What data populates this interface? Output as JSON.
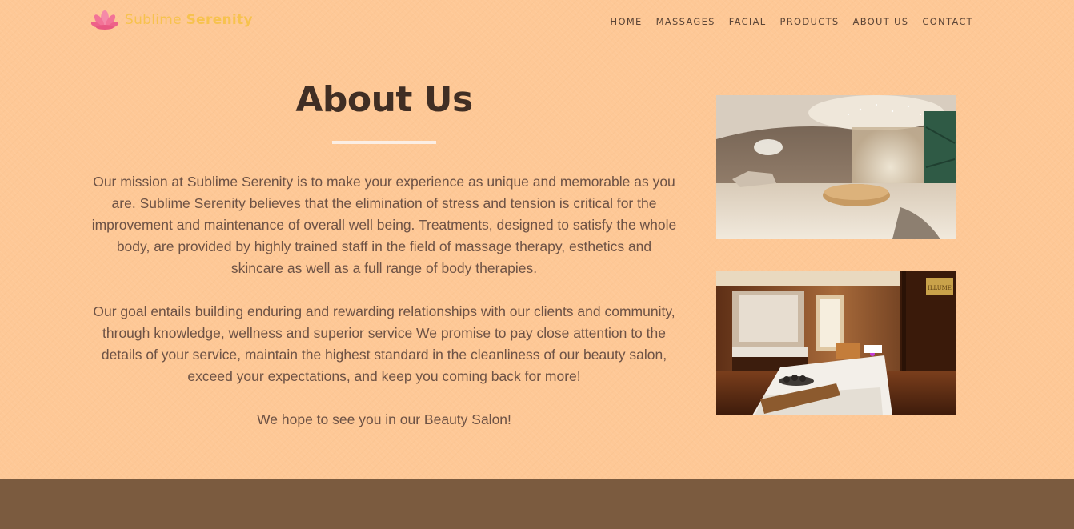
{
  "brand": {
    "name_part1": "Sublime",
    "name_part2": "Serenity",
    "logo_icon": "lotus-icon",
    "color": "#f7c24e"
  },
  "nav": {
    "items": [
      "HOME",
      "MASSAGES",
      "FACIAL",
      "PRODUCTS",
      "ABOUT US",
      "CONTACT"
    ]
  },
  "about": {
    "title": "About Us",
    "paragraphs": [
      "Our mission at Sublime Serenity is to make your experience as unique and memorable as you are. Sublime Serenity believes that the elimination of stress and tension is critical for the improvement and maintenance of overall well being. Treatments, designed to satisfy the whole body, are provided by highly trained staff in the field of massage therapy, esthetics and skincare as well as a full range of body therapies.",
      "Our goal entails building enduring and rewarding relationships with our clients and community, through knowledge, wellness and superior service We promise to pay close attention to the details of your service, maintain the highest standard in the cleanliness of our beauty salon, exceed your expectations, and keep you coming back for more!",
      "We hope to see you in our Beauty Salon!"
    ]
  },
  "images": {
    "lounge_alt": "spa-lounge-photo",
    "room_alt": "massage-room-photo",
    "room_sign": "ILLUME"
  },
  "colors": {
    "background": "#fec896",
    "heading": "#402e24",
    "body_text": "#6d5245",
    "nav_text": "#5c4536",
    "footer": "#7b5b3f",
    "divider": "#fbeee4"
  }
}
